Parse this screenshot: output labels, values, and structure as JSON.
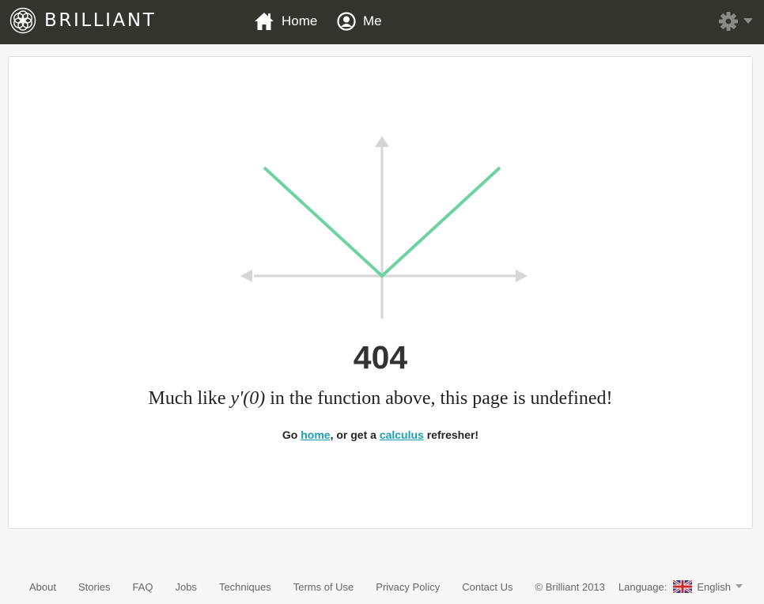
{
  "header": {
    "logo_text": "BRILLIANT",
    "nav": {
      "home_label": "Home",
      "me_label": "Me"
    }
  },
  "main": {
    "error_code": "404",
    "message": {
      "prefix": "Much like ",
      "function": "y'(0)",
      "suffix": " in the function above, this page is undefined!"
    },
    "hint": {
      "prefix": "Go ",
      "home_link": "home",
      "middle": ", or get a ",
      "calculus_link": "calculus",
      "suffix": " refresher!"
    }
  },
  "footer": {
    "links": [
      "About",
      "Stories",
      "FAQ",
      "Jobs",
      "Techniques",
      "Terms of Use",
      "Privacy Policy",
      "Contact Us"
    ],
    "copyright": "© Brilliant 2013",
    "language_label": "Language:",
    "language_value": "English"
  },
  "colors": {
    "topbar": "#34342f",
    "accent_green": "#6fd39f",
    "link": "#19a0b3",
    "axis": "#d6d6d6"
  },
  "icons": [
    "brilliant-logo-icon",
    "home-icon",
    "user-icon",
    "gear-icon",
    "chevron-down-icon",
    "uk-flag-icon"
  ]
}
